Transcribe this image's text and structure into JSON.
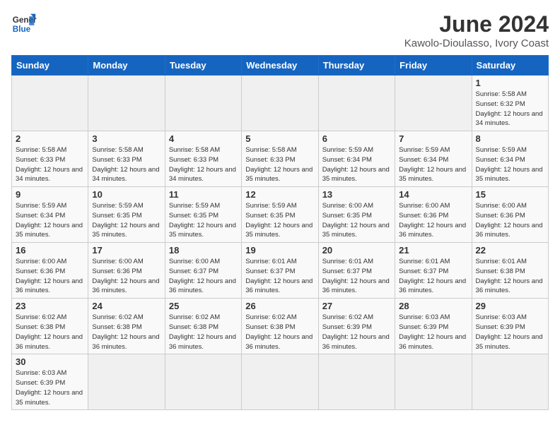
{
  "header": {
    "logo_general": "General",
    "logo_blue": "Blue",
    "month_title": "June 2024",
    "subtitle": "Kawolo-Dioulasso, Ivory Coast"
  },
  "weekdays": [
    "Sunday",
    "Monday",
    "Tuesday",
    "Wednesday",
    "Thursday",
    "Friday",
    "Saturday"
  ],
  "weeks": [
    [
      {
        "day": "",
        "info": ""
      },
      {
        "day": "",
        "info": ""
      },
      {
        "day": "",
        "info": ""
      },
      {
        "day": "",
        "info": ""
      },
      {
        "day": "",
        "info": ""
      },
      {
        "day": "",
        "info": ""
      },
      {
        "day": "1",
        "info": "Sunrise: 5:58 AM\nSunset: 6:32 PM\nDaylight: 12 hours and 34 minutes."
      }
    ],
    [
      {
        "day": "2",
        "info": "Sunrise: 5:58 AM\nSunset: 6:33 PM\nDaylight: 12 hours and 34 minutes."
      },
      {
        "day": "3",
        "info": "Sunrise: 5:58 AM\nSunset: 6:33 PM\nDaylight: 12 hours and 34 minutes."
      },
      {
        "day": "4",
        "info": "Sunrise: 5:58 AM\nSunset: 6:33 PM\nDaylight: 12 hours and 34 minutes."
      },
      {
        "day": "5",
        "info": "Sunrise: 5:58 AM\nSunset: 6:33 PM\nDaylight: 12 hours and 35 minutes."
      },
      {
        "day": "6",
        "info": "Sunrise: 5:59 AM\nSunset: 6:34 PM\nDaylight: 12 hours and 35 minutes."
      },
      {
        "day": "7",
        "info": "Sunrise: 5:59 AM\nSunset: 6:34 PM\nDaylight: 12 hours and 35 minutes."
      },
      {
        "day": "8",
        "info": "Sunrise: 5:59 AM\nSunset: 6:34 PM\nDaylight: 12 hours and 35 minutes."
      }
    ],
    [
      {
        "day": "9",
        "info": "Sunrise: 5:59 AM\nSunset: 6:34 PM\nDaylight: 12 hours and 35 minutes."
      },
      {
        "day": "10",
        "info": "Sunrise: 5:59 AM\nSunset: 6:35 PM\nDaylight: 12 hours and 35 minutes."
      },
      {
        "day": "11",
        "info": "Sunrise: 5:59 AM\nSunset: 6:35 PM\nDaylight: 12 hours and 35 minutes."
      },
      {
        "day": "12",
        "info": "Sunrise: 5:59 AM\nSunset: 6:35 PM\nDaylight: 12 hours and 35 minutes."
      },
      {
        "day": "13",
        "info": "Sunrise: 6:00 AM\nSunset: 6:35 PM\nDaylight: 12 hours and 35 minutes."
      },
      {
        "day": "14",
        "info": "Sunrise: 6:00 AM\nSunset: 6:36 PM\nDaylight: 12 hours and 36 minutes."
      },
      {
        "day": "15",
        "info": "Sunrise: 6:00 AM\nSunset: 6:36 PM\nDaylight: 12 hours and 36 minutes."
      }
    ],
    [
      {
        "day": "16",
        "info": "Sunrise: 6:00 AM\nSunset: 6:36 PM\nDaylight: 12 hours and 36 minutes."
      },
      {
        "day": "17",
        "info": "Sunrise: 6:00 AM\nSunset: 6:36 PM\nDaylight: 12 hours and 36 minutes."
      },
      {
        "day": "18",
        "info": "Sunrise: 6:00 AM\nSunset: 6:37 PM\nDaylight: 12 hours and 36 minutes."
      },
      {
        "day": "19",
        "info": "Sunrise: 6:01 AM\nSunset: 6:37 PM\nDaylight: 12 hours and 36 minutes."
      },
      {
        "day": "20",
        "info": "Sunrise: 6:01 AM\nSunset: 6:37 PM\nDaylight: 12 hours and 36 minutes."
      },
      {
        "day": "21",
        "info": "Sunrise: 6:01 AM\nSunset: 6:37 PM\nDaylight: 12 hours and 36 minutes."
      },
      {
        "day": "22",
        "info": "Sunrise: 6:01 AM\nSunset: 6:38 PM\nDaylight: 12 hours and 36 minutes."
      }
    ],
    [
      {
        "day": "23",
        "info": "Sunrise: 6:02 AM\nSunset: 6:38 PM\nDaylight: 12 hours and 36 minutes."
      },
      {
        "day": "24",
        "info": "Sunrise: 6:02 AM\nSunset: 6:38 PM\nDaylight: 12 hours and 36 minutes."
      },
      {
        "day": "25",
        "info": "Sunrise: 6:02 AM\nSunset: 6:38 PM\nDaylight: 12 hours and 36 minutes."
      },
      {
        "day": "26",
        "info": "Sunrise: 6:02 AM\nSunset: 6:38 PM\nDaylight: 12 hours and 36 minutes."
      },
      {
        "day": "27",
        "info": "Sunrise: 6:02 AM\nSunset: 6:39 PM\nDaylight: 12 hours and 36 minutes."
      },
      {
        "day": "28",
        "info": "Sunrise: 6:03 AM\nSunset: 6:39 PM\nDaylight: 12 hours and 36 minutes."
      },
      {
        "day": "29",
        "info": "Sunrise: 6:03 AM\nSunset: 6:39 PM\nDaylight: 12 hours and 35 minutes."
      }
    ],
    [
      {
        "day": "30",
        "info": "Sunrise: 6:03 AM\nSunset: 6:39 PM\nDaylight: 12 hours and 35 minutes."
      },
      {
        "day": "",
        "info": ""
      },
      {
        "day": "",
        "info": ""
      },
      {
        "day": "",
        "info": ""
      },
      {
        "day": "",
        "info": ""
      },
      {
        "day": "",
        "info": ""
      },
      {
        "day": "",
        "info": ""
      }
    ]
  ]
}
